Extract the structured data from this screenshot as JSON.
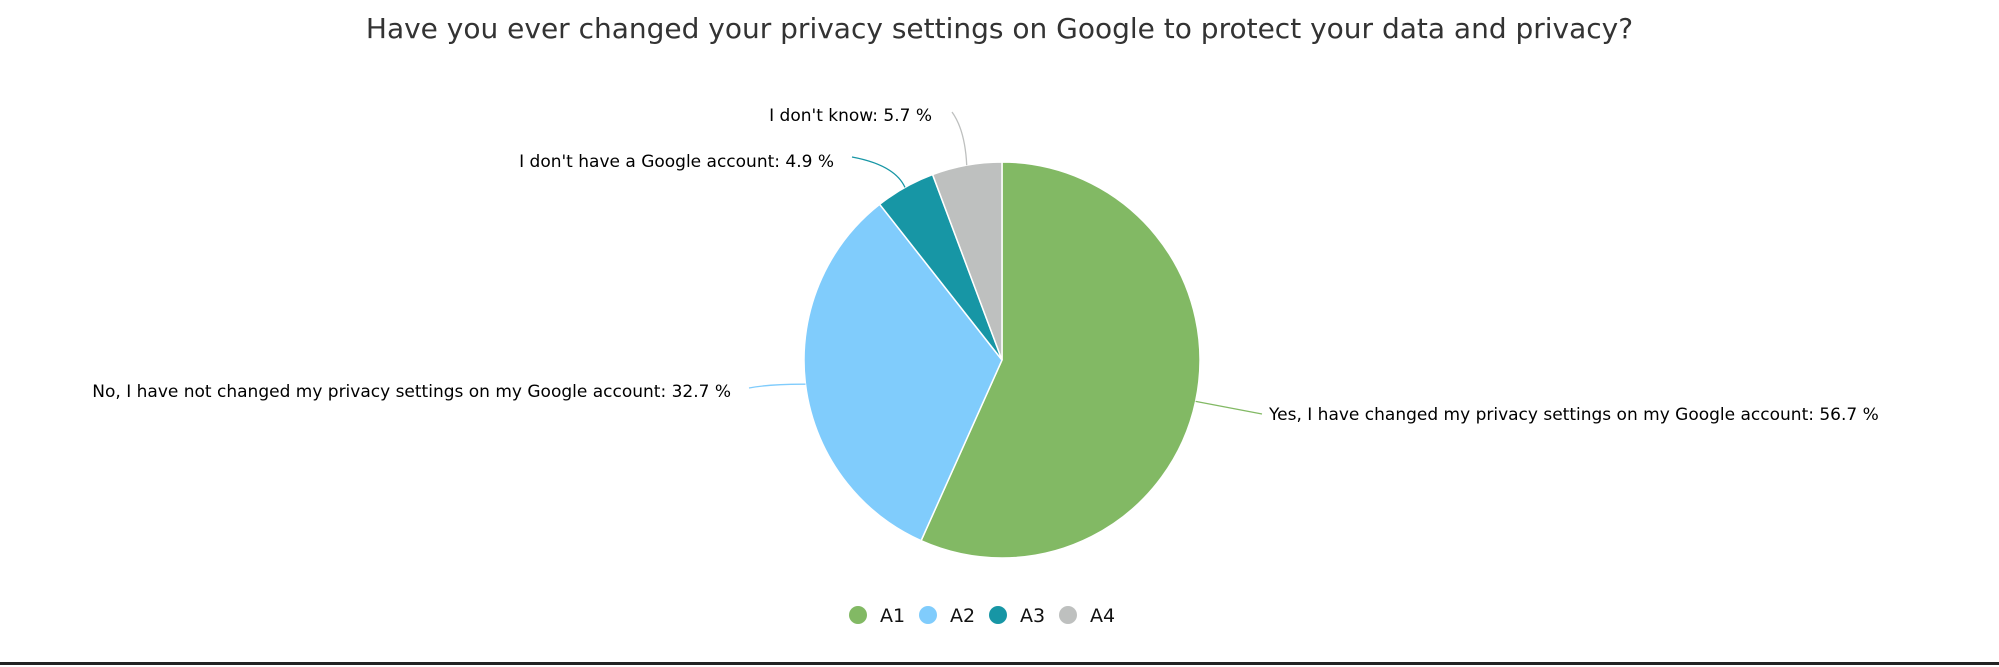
{
  "chart_data": {
    "type": "pie",
    "title": "Have you ever changed your privacy settings on Google to protect your data and privacy?",
    "unit": "%",
    "slices": [
      {
        "key": "A1",
        "label": "Yes, I have changed my privacy settings on my Google account",
        "value": 56.7,
        "color": "#82b964"
      },
      {
        "key": "A2",
        "label": "No, I have not changed my privacy settings on my Google account",
        "value": 32.7,
        "color": "#80ccfc"
      },
      {
        "key": "A3",
        "label": "I don't have a Google account",
        "value": 4.9,
        "color": "#1796a5"
      },
      {
        "key": "A4",
        "label": "I don't know",
        "value": 5.7,
        "color": "#bec0bf"
      }
    ],
    "legend": {
      "position": "bottom",
      "entries": [
        "A1",
        "A2",
        "A3",
        "A4"
      ]
    }
  }
}
